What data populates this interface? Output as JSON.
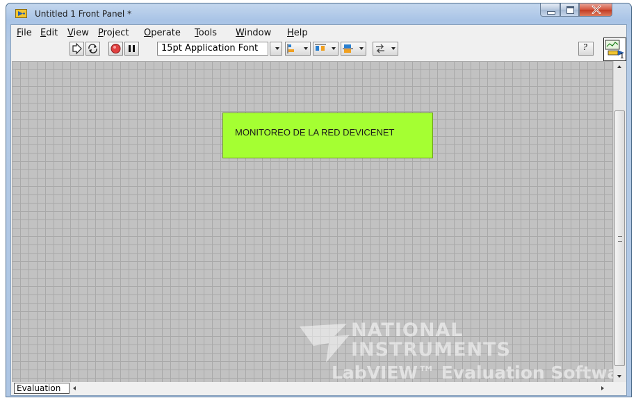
{
  "window": {
    "title": "Untitled 1 Front Panel *"
  },
  "menu": [
    {
      "label": "File",
      "key": "F",
      "rest": "ile"
    },
    {
      "label": "Edit",
      "key": "E",
      "rest": "dit"
    },
    {
      "label": "View",
      "key": "V",
      "rest": "iew"
    },
    {
      "label": "Project",
      "key": "P",
      "rest": "roject"
    },
    {
      "label": "Operate",
      "key": "O",
      "rest": "perate"
    },
    {
      "label": "Tools",
      "key": "T",
      "rest": "ools"
    },
    {
      "label": "Window",
      "key": "W",
      "rest": "indow"
    },
    {
      "label": "Help",
      "key": "H",
      "rest": "elp"
    }
  ],
  "toolbar": {
    "font": "15pt Application Font",
    "help_glyph": "?"
  },
  "vi_icon": {
    "number": "1"
  },
  "panel": {
    "title_box_text": "MONITOREO DE LA RED DEVICENET"
  },
  "watermark": {
    "line1": "NATIONAL",
    "line2": "INSTRUMENTS",
    "line3": "LabVIEW™ Evaluation Software"
  },
  "statusbar": {
    "tab_label": "Evaluation"
  },
  "colors": {
    "title_box": "#a5ff32",
    "panel_background": "#c2c2c2",
    "close_button": "#c9462d"
  }
}
